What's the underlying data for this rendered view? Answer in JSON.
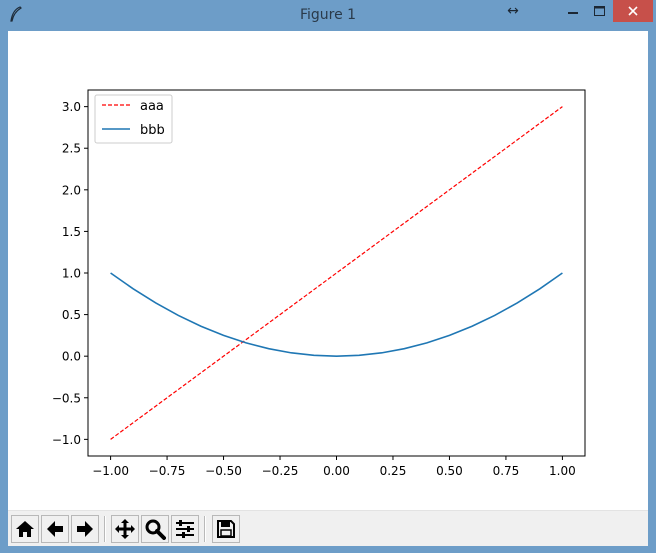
{
  "window": {
    "title": "Figure 1",
    "resize_glyph": "↔",
    "colors": {
      "titlebar": "#6d9dc8",
      "close": "#c7504a"
    }
  },
  "toolbar": {
    "buttons": [
      {
        "name": "home",
        "icon": "home-icon"
      },
      {
        "name": "back",
        "icon": "arrow-left-icon"
      },
      {
        "name": "forward",
        "icon": "arrow-right-icon"
      },
      {
        "name": "pan",
        "icon": "move-icon"
      },
      {
        "name": "zoom",
        "icon": "magnifier-icon"
      },
      {
        "name": "configure-subplots",
        "icon": "sliders-icon"
      },
      {
        "name": "save",
        "icon": "floppy-disk-icon"
      }
    ]
  },
  "chart_data": {
    "type": "line",
    "title": "",
    "xlabel": "",
    "ylabel": "",
    "xlim": [
      -1.1,
      1.1
    ],
    "ylim": [
      -1.2,
      3.2
    ],
    "xticks": [
      -1.0,
      -0.75,
      -0.5,
      -0.25,
      0.0,
      0.25,
      0.5,
      0.75,
      1.0
    ],
    "xtick_labels": [
      "−1.00",
      "−0.75",
      "−0.50",
      "−0.25",
      "0.00",
      "0.25",
      "0.50",
      "0.75",
      "1.00"
    ],
    "yticks": [
      -1.0,
      -0.5,
      0.0,
      0.5,
      1.0,
      1.5,
      2.0,
      2.5,
      3.0
    ],
    "ytick_labels": [
      "−1.0",
      "−0.5",
      "0.0",
      "0.5",
      "1.0",
      "1.5",
      "2.0",
      "2.5",
      "3.0"
    ],
    "grid": false,
    "legend_position": "upper-left",
    "series": [
      {
        "name": "aaa",
        "color": "#ff0000",
        "linestyle": "dashed",
        "x": [
          -1.0,
          1.0
        ],
        "y": [
          -1.0,
          3.0
        ]
      },
      {
        "name": "bbb",
        "color": "#1f77b4",
        "linestyle": "solid",
        "x": [
          -1.0,
          -0.9,
          -0.8,
          -0.7,
          -0.6,
          -0.5,
          -0.4,
          -0.3,
          -0.2,
          -0.1,
          0.0,
          0.1,
          0.2,
          0.3,
          0.4,
          0.5,
          0.6,
          0.7,
          0.8,
          0.9,
          1.0
        ],
        "y": [
          1.0,
          0.81,
          0.64,
          0.49,
          0.36,
          0.25,
          0.16,
          0.09,
          0.04,
          0.01,
          0.0,
          0.01,
          0.04,
          0.09,
          0.16,
          0.25,
          0.36,
          0.49,
          0.64,
          0.81,
          1.0
        ]
      }
    ]
  }
}
